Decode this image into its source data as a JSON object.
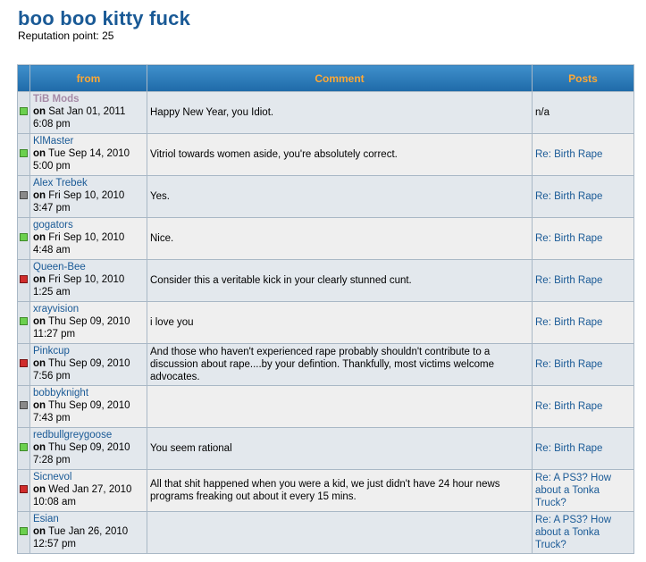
{
  "profile": {
    "username": "boo boo kitty fuck",
    "reputation_text": "Reputation point: 25"
  },
  "table": {
    "headers": {
      "from": "from",
      "comment": "Comment",
      "posts": "Posts"
    },
    "rows": [
      {
        "indicator": "green",
        "user": "TiB Mods",
        "is_mod": true,
        "on_label": "on",
        "date": "Sat Jan 01, 2011",
        "time": "6:08 pm",
        "comment": "Happy New Year, you Idiot.",
        "post": "n/a",
        "post_is_link": false
      },
      {
        "indicator": "green",
        "user": "KlMaster",
        "on_label": "on",
        "date": "Tue Sep 14, 2010",
        "time": "5:00 pm",
        "comment": "Vitriol towards women aside, you're absolutely correct.",
        "post": "Re: Birth Rape",
        "post_is_link": true
      },
      {
        "indicator": "gray",
        "user": "Alex Trebek",
        "on_label": "on",
        "date": "Fri Sep 10, 2010",
        "time": "3:47 pm",
        "comment": "Yes.",
        "post": "Re: Birth Rape",
        "post_is_link": true
      },
      {
        "indicator": "green",
        "user": "gogators",
        "on_label": "on",
        "date": "Fri Sep 10, 2010",
        "time": "4:48 am",
        "comment": "Nice.",
        "post": "Re: Birth Rape",
        "post_is_link": true
      },
      {
        "indicator": "red",
        "user": "Queen-Bee",
        "on_label": "on",
        "date": "Fri Sep 10, 2010",
        "time": "1:25 am",
        "comment": "Consider this a veritable kick in your clearly stunned cunt.",
        "post": "Re: Birth Rape",
        "post_is_link": true
      },
      {
        "indicator": "green",
        "user": "xrayvision",
        "on_label": "on",
        "date": "Thu Sep 09, 2010",
        "time": "11:27 pm",
        "comment": "i love you",
        "post": "Re: Birth Rape",
        "post_is_link": true
      },
      {
        "indicator": "red",
        "user": "Pinkcup",
        "on_label": "on",
        "date": "Thu Sep 09, 2010",
        "time": "7:56 pm",
        "comment": "And those who haven't experienced rape probably shouldn't contribute to a discussion about rape....by your defintion. Thankfully, most victims welcome advocates.",
        "post": "Re: Birth Rape",
        "post_is_link": true
      },
      {
        "indicator": "gray",
        "user": "bobbyknight",
        "on_label": "on",
        "date": "Thu Sep 09, 2010",
        "time": "7:43 pm",
        "comment": "",
        "post": "Re: Birth Rape",
        "post_is_link": true
      },
      {
        "indicator": "green",
        "user": "redbullgreygoose",
        "on_label": "on",
        "date": "Thu Sep 09, 2010",
        "time": "7:28 pm",
        "comment": "You seem rational",
        "post": "Re: Birth Rape",
        "post_is_link": true
      },
      {
        "indicator": "red",
        "user": "Sicnevol",
        "on_label": "on",
        "date": "Wed Jan 27, 2010",
        "time": "10:08 am",
        "comment": "All that shit happened when you were a kid, we just didn't have 24 hour news programs freaking out about it every 15 mins.",
        "post": "Re: A PS3? How about a Tonka Truck?",
        "post_is_link": true
      },
      {
        "indicator": "green",
        "user": "Esian",
        "on_label": "on",
        "date": "Tue Jan 26, 2010",
        "time": "12:57 pm",
        "comment": "",
        "post": "Re: A PS3? How about a Tonka Truck?",
        "post_is_link": true
      }
    ]
  }
}
